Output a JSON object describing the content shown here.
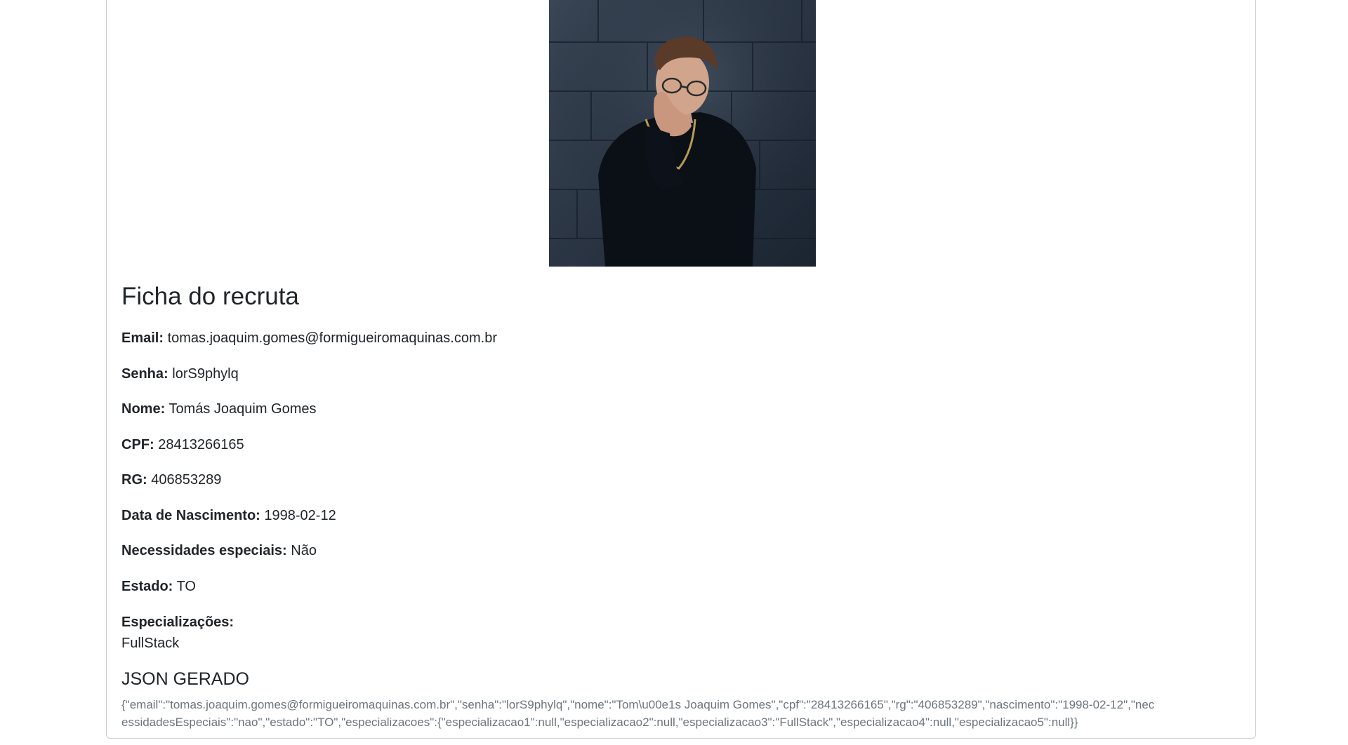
{
  "photo": {
    "alt": "Foto do recruta",
    "icon": "person-photo"
  },
  "title": "Ficha do recruta",
  "fields": [
    {
      "label": "Email:",
      "value": "tomas.joaquim.gomes@formigueiromaquinas.com.br"
    },
    {
      "label": "Senha:",
      "value": "lorS9phylq"
    },
    {
      "label": "Nome:",
      "value": "Tomás Joaquim Gomes"
    },
    {
      "label": "CPF:",
      "value": "28413266165"
    },
    {
      "label": "RG:",
      "value": "406853289"
    },
    {
      "label": "Data de Nascimento:",
      "value": "1998-02-12"
    },
    {
      "label": "Necessidades especiais:",
      "value": "Não"
    },
    {
      "label": "Estado:",
      "value": "TO"
    }
  ],
  "especializacoes": {
    "label": "Especializações:",
    "items": [
      "FullStack"
    ]
  },
  "json_section": {
    "title": "JSON GERADO",
    "text": "{\"email\":\"tomas.joaquim.gomes@formigueiromaquinas.com.br\",\"senha\":\"lorS9phylq\",\"nome\":\"Tom\\u00e1s Joaquim Gomes\",\"cpf\":\"28413266165\",\"rg\":\"406853289\",\"nascimento\":\"1998-02-12\",\"necessidadesEspeciais\":\"nao\",\"estado\":\"TO\",\"especializacoes\":{\"especializacao1\":null,\"especializacao2\":null,\"especializacao3\":\"FullStack\",\"especializacao4\":null,\"especializacao5\":null}}"
  }
}
